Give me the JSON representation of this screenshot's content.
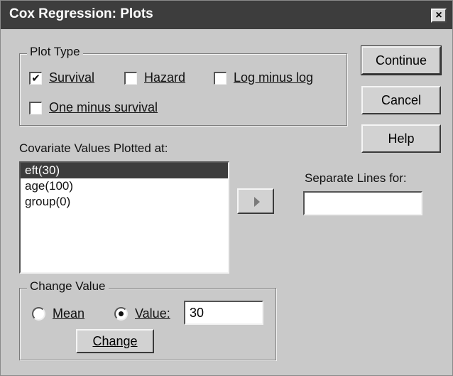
{
  "window": {
    "title": "Cox Regression: Plots",
    "close_glyph": "×"
  },
  "plot_type": {
    "label": "Plot Type",
    "survival": {
      "label": "Survival",
      "checked": true
    },
    "hazard": {
      "label": "Hazard",
      "checked": false
    },
    "log_minus_log": {
      "label": "Log minus log",
      "checked": false
    },
    "one_minus_survival": {
      "label": "One minus survival",
      "checked": false
    }
  },
  "buttons": {
    "continue": "Continue",
    "cancel": "Cancel",
    "help": "Help",
    "change": "Change"
  },
  "covariates": {
    "label": "Covariate Values Plotted at:",
    "items": [
      "eft(30)",
      "age(100)",
      "group(0)"
    ],
    "selected_index": 0
  },
  "separate_lines": {
    "label": "Separate Lines for:",
    "value": ""
  },
  "move_button": {
    "icon": "right-arrow-icon"
  },
  "change_value": {
    "label": "Change Value",
    "mean": {
      "label": "Mean",
      "selected": false
    },
    "value": {
      "label": "Value:",
      "selected": true
    },
    "value_input": "30"
  },
  "colors": {
    "titlebar": "#3d3d3d",
    "dialog_bg": "#c9c9c9",
    "selection": "#3d3d3d"
  }
}
